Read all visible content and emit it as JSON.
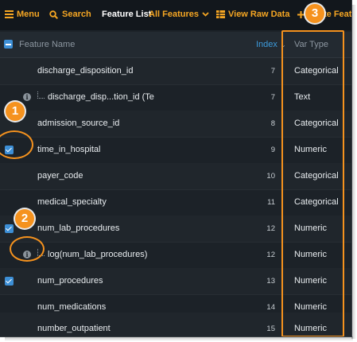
{
  "toolbar": {
    "menu_label": "Menu",
    "search_label": "Search",
    "feature_list_label": "Feature List",
    "all_features_label": "All Features",
    "view_raw_label": "View Raw Data",
    "create_label": "te Featu"
  },
  "table": {
    "columns": {
      "name": "Feature Name",
      "index": "Index",
      "var_type": "Var Type"
    },
    "rows": [
      {
        "name": "discharge_disposition_id",
        "index": "7",
        "type": "Categorical",
        "checked": false,
        "derived": false
      },
      {
        "name": "discharge_disp...tion_id (Te",
        "index": "7",
        "type": "Text",
        "checked": false,
        "derived": true
      },
      {
        "name": "admission_source_id",
        "index": "8",
        "type": "Categorical",
        "checked": false,
        "derived": false
      },
      {
        "name": "time_in_hospital",
        "index": "9",
        "type": "Numeric",
        "checked": true,
        "derived": false
      },
      {
        "name": "payer_code",
        "index": "10",
        "type": "Categorical",
        "checked": false,
        "derived": false
      },
      {
        "name": "medical_specialty",
        "index": "11",
        "type": "Categorical",
        "checked": false,
        "derived": false
      },
      {
        "name": "num_lab_procedures",
        "index": "12",
        "type": "Numeric",
        "checked": true,
        "derived": false
      },
      {
        "name": "log(num_lab_procedures)",
        "index": "12",
        "type": "Numeric",
        "checked": false,
        "derived": true
      },
      {
        "name": "num_procedures",
        "index": "13",
        "type": "Numeric",
        "checked": true,
        "derived": false
      },
      {
        "name": "num_medications",
        "index": "14",
        "type": "Numeric",
        "checked": false,
        "derived": false
      },
      {
        "name": "number_outpatient",
        "index": "15",
        "type": "Numeric",
        "checked": false,
        "derived": false
      }
    ]
  },
  "callouts": {
    "one": "1",
    "two": "2",
    "three": "3"
  },
  "colors": {
    "accent": "#f5a623",
    "callout": "#f5921e",
    "checkbox": "#3d8fd6",
    "background": "#1c2228"
  },
  "icons": [
    "hamburger-menu-icon",
    "search-icon",
    "chevron-down-icon",
    "table-icon",
    "plus-icon",
    "info-icon",
    "sort-down-icon"
  ]
}
